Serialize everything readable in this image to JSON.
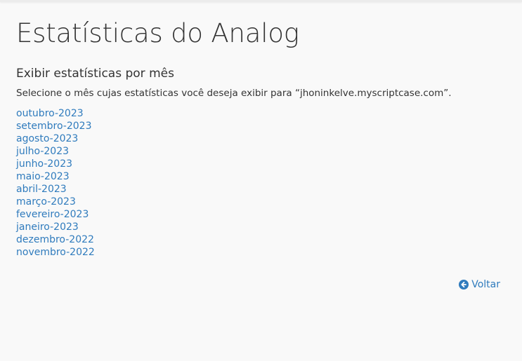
{
  "page": {
    "title": "Estatísticas do Analog"
  },
  "section": {
    "title": "Exibir estatísticas por mês",
    "description": "Selecione o mês cujas estatísticas você deseja exibir para “jhoninkelve.myscriptcase.com”."
  },
  "months": [
    "outubro-2023",
    "setembro-2023",
    "agosto-2023",
    "julho-2023",
    "junho-2023",
    "maio-2023",
    "abril-2023",
    "março-2023",
    "fevereiro-2023",
    "janeiro-2023",
    "dezembro-2022",
    "novembro-2022"
  ],
  "back": {
    "label": "Voltar",
    "icon": "arrow-circle-left-icon"
  },
  "colors": {
    "link": "#2f7bbd",
    "background": "#f9f9f9"
  }
}
